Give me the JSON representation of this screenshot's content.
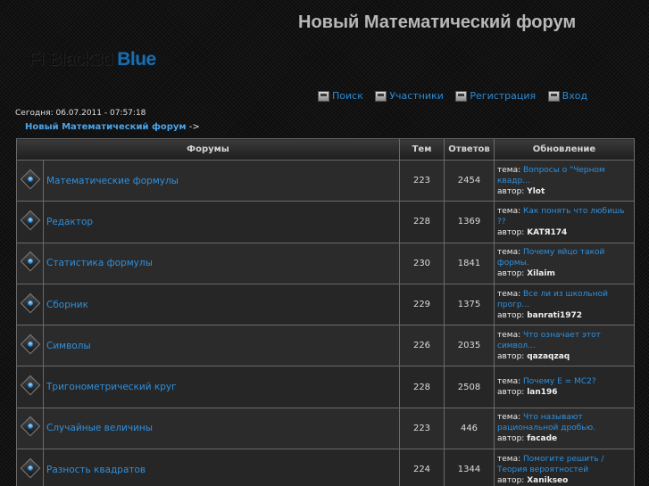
{
  "header": {
    "site_title": "Новый Математический форум",
    "logo_text_a": "FI Black3d",
    "logo_text_b": "Blue"
  },
  "nav": [
    {
      "label": "Поиск",
      "icon": "search-icon"
    },
    {
      "label": "Участники",
      "icon": "members-icon"
    },
    {
      "label": "Регистрация",
      "icon": "register-icon"
    },
    {
      "label": "Вход",
      "icon": "login-icon"
    }
  ],
  "today": "Сегодня: 06.07.2011 - 07:57:18",
  "breadcrumb": {
    "link": "Новый Математический форум",
    "arrow": "->"
  },
  "table": {
    "headers": {
      "forums": "Форумы",
      "topics": "Тем",
      "replies": "Ответов",
      "updated": "Обновление"
    },
    "labels": {
      "topic": "тема:",
      "author": "автор:"
    },
    "rows": [
      {
        "name": "Математические формулы",
        "topics": "223",
        "replies": "2454",
        "last_topic": "Вопросы о \"Черном квадр...",
        "last_author": "Ylot"
      },
      {
        "name": "Редактор",
        "topics": "228",
        "replies": "1369",
        "last_topic": "Как понять что любишь ??",
        "last_author": "KATЯ174"
      },
      {
        "name": "Статистика формулы",
        "topics": "230",
        "replies": "1841",
        "last_topic": "Почему яйцо такой формы.",
        "last_author": "Xilaim"
      },
      {
        "name": "Сборник",
        "topics": "229",
        "replies": "1375",
        "last_topic": "Все ли из школьной прогр...",
        "last_author": "banrati1972"
      },
      {
        "name": "Символы",
        "topics": "226",
        "replies": "2035",
        "last_topic": "Что означает этот символ...",
        "last_author": "qazaqzaq"
      },
      {
        "name": "Тригонометрический круг",
        "topics": "228",
        "replies": "2508",
        "last_topic": "Почему E = MC2?",
        "last_author": "lan196"
      },
      {
        "name": "Случайные величины",
        "topics": "223",
        "replies": "446",
        "last_topic": "Что называют рациональной дробью.",
        "last_author": "facade"
      },
      {
        "name": "Разность квадратов",
        "topics": "224",
        "replies": "1344",
        "last_topic": "Помогите решить / Теория вероятностей",
        "last_author": "Xanikseo"
      }
    ]
  },
  "colors": {
    "accent": "#2e90de",
    "background": "#0c0c0c",
    "cell": "#2b2b2b"
  }
}
